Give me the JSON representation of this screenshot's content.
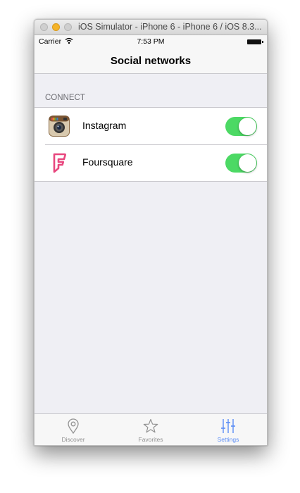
{
  "window": {
    "title": "iOS Simulator - iPhone 6 - iPhone 6 / iOS 8.3..."
  },
  "status_bar": {
    "carrier": "Carrier",
    "time": "7:53 PM"
  },
  "nav_bar": {
    "title": "Social networks"
  },
  "section": {
    "header": "CONNECT",
    "items": [
      {
        "label": "Instagram",
        "icon": "instagram-icon",
        "toggle_on": true
      },
      {
        "label": "Foursquare",
        "icon": "foursquare-icon",
        "toggle_on": true
      }
    ]
  },
  "tab_bar": {
    "tabs": [
      {
        "label": "Discover",
        "icon": "map-pin-icon",
        "active": false
      },
      {
        "label": "Favorites",
        "icon": "star-icon",
        "active": false
      },
      {
        "label": "Settings",
        "icon": "sliders-icon",
        "active": true
      }
    ]
  },
  "colors": {
    "toggle_on": "#4cd964",
    "tab_active": "#5b8df5",
    "tab_inactive": "#929292",
    "foursquare_brand": "#e8477e",
    "group_background": "#efeff4"
  }
}
